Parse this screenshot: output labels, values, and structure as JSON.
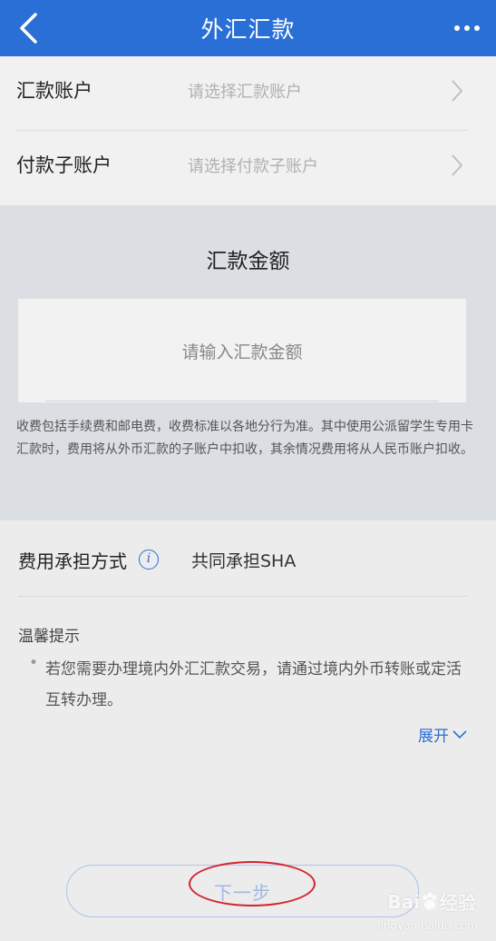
{
  "header": {
    "title": "外汇汇款",
    "back_icon": "chevron-left-icon",
    "more_icon": "more-dots-icon",
    "bg_color": "#2a6fd6"
  },
  "form": {
    "remit_account": {
      "label": "汇款账户",
      "placeholder": "请选择汇款账户"
    },
    "pay_sub_account": {
      "label": "付款子账户",
      "placeholder": "请选择付款子账户"
    }
  },
  "amount": {
    "title": "汇款金额",
    "placeholder": "请输入汇款金额",
    "note": "收费包括手续费和邮电费，收费标准以各地分行为准。其中使用公派留学生专用卡汇款时，费用将从外币汇款的子账户中扣收，其余情况费用将从人民币账户扣收。"
  },
  "fee": {
    "label": "费用承担方式",
    "info_icon": "i",
    "value": "共同承担SHA"
  },
  "tips": {
    "title": "温馨提示",
    "bullet": "•",
    "text": "若您需要办理境内外汇汇款交易，请通过境内外币转账或定活互转办理。",
    "expand_label": "展开"
  },
  "next_button": {
    "label": "下一步"
  },
  "watermark": {
    "brand": "Bai",
    "brand_suffix": "经验",
    "sub": "jingyan.baidu.com"
  }
}
